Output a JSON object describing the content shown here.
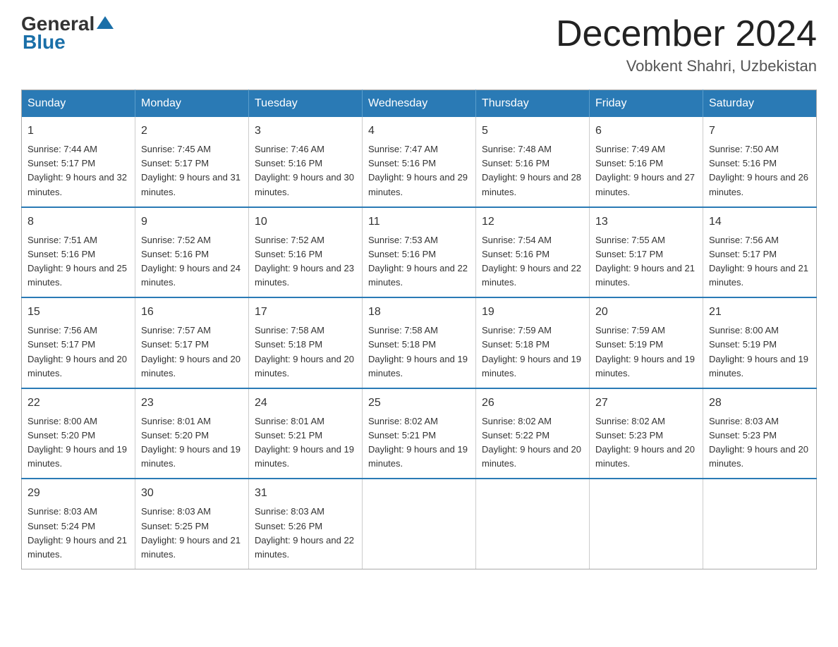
{
  "logo": {
    "general": "General",
    "blue": "Blue"
  },
  "title": "December 2024",
  "location": "Vobkent Shahri, Uzbekistan",
  "days_of_week": [
    "Sunday",
    "Monday",
    "Tuesday",
    "Wednesday",
    "Thursday",
    "Friday",
    "Saturday"
  ],
  "weeks": [
    [
      {
        "day": "1",
        "sunrise": "Sunrise: 7:44 AM",
        "sunset": "Sunset: 5:17 PM",
        "daylight": "Daylight: 9 hours and 32 minutes."
      },
      {
        "day": "2",
        "sunrise": "Sunrise: 7:45 AM",
        "sunset": "Sunset: 5:17 PM",
        "daylight": "Daylight: 9 hours and 31 minutes."
      },
      {
        "day": "3",
        "sunrise": "Sunrise: 7:46 AM",
        "sunset": "Sunset: 5:16 PM",
        "daylight": "Daylight: 9 hours and 30 minutes."
      },
      {
        "day": "4",
        "sunrise": "Sunrise: 7:47 AM",
        "sunset": "Sunset: 5:16 PM",
        "daylight": "Daylight: 9 hours and 29 minutes."
      },
      {
        "day": "5",
        "sunrise": "Sunrise: 7:48 AM",
        "sunset": "Sunset: 5:16 PM",
        "daylight": "Daylight: 9 hours and 28 minutes."
      },
      {
        "day": "6",
        "sunrise": "Sunrise: 7:49 AM",
        "sunset": "Sunset: 5:16 PM",
        "daylight": "Daylight: 9 hours and 27 minutes."
      },
      {
        "day": "7",
        "sunrise": "Sunrise: 7:50 AM",
        "sunset": "Sunset: 5:16 PM",
        "daylight": "Daylight: 9 hours and 26 minutes."
      }
    ],
    [
      {
        "day": "8",
        "sunrise": "Sunrise: 7:51 AM",
        "sunset": "Sunset: 5:16 PM",
        "daylight": "Daylight: 9 hours and 25 minutes."
      },
      {
        "day": "9",
        "sunrise": "Sunrise: 7:52 AM",
        "sunset": "Sunset: 5:16 PM",
        "daylight": "Daylight: 9 hours and 24 minutes."
      },
      {
        "day": "10",
        "sunrise": "Sunrise: 7:52 AM",
        "sunset": "Sunset: 5:16 PM",
        "daylight": "Daylight: 9 hours and 23 minutes."
      },
      {
        "day": "11",
        "sunrise": "Sunrise: 7:53 AM",
        "sunset": "Sunset: 5:16 PM",
        "daylight": "Daylight: 9 hours and 22 minutes."
      },
      {
        "day": "12",
        "sunrise": "Sunrise: 7:54 AM",
        "sunset": "Sunset: 5:16 PM",
        "daylight": "Daylight: 9 hours and 22 minutes."
      },
      {
        "day": "13",
        "sunrise": "Sunrise: 7:55 AM",
        "sunset": "Sunset: 5:17 PM",
        "daylight": "Daylight: 9 hours and 21 minutes."
      },
      {
        "day": "14",
        "sunrise": "Sunrise: 7:56 AM",
        "sunset": "Sunset: 5:17 PM",
        "daylight": "Daylight: 9 hours and 21 minutes."
      }
    ],
    [
      {
        "day": "15",
        "sunrise": "Sunrise: 7:56 AM",
        "sunset": "Sunset: 5:17 PM",
        "daylight": "Daylight: 9 hours and 20 minutes."
      },
      {
        "day": "16",
        "sunrise": "Sunrise: 7:57 AM",
        "sunset": "Sunset: 5:17 PM",
        "daylight": "Daylight: 9 hours and 20 minutes."
      },
      {
        "day": "17",
        "sunrise": "Sunrise: 7:58 AM",
        "sunset": "Sunset: 5:18 PM",
        "daylight": "Daylight: 9 hours and 20 minutes."
      },
      {
        "day": "18",
        "sunrise": "Sunrise: 7:58 AM",
        "sunset": "Sunset: 5:18 PM",
        "daylight": "Daylight: 9 hours and 19 minutes."
      },
      {
        "day": "19",
        "sunrise": "Sunrise: 7:59 AM",
        "sunset": "Sunset: 5:18 PM",
        "daylight": "Daylight: 9 hours and 19 minutes."
      },
      {
        "day": "20",
        "sunrise": "Sunrise: 7:59 AM",
        "sunset": "Sunset: 5:19 PM",
        "daylight": "Daylight: 9 hours and 19 minutes."
      },
      {
        "day": "21",
        "sunrise": "Sunrise: 8:00 AM",
        "sunset": "Sunset: 5:19 PM",
        "daylight": "Daylight: 9 hours and 19 minutes."
      }
    ],
    [
      {
        "day": "22",
        "sunrise": "Sunrise: 8:00 AM",
        "sunset": "Sunset: 5:20 PM",
        "daylight": "Daylight: 9 hours and 19 minutes."
      },
      {
        "day": "23",
        "sunrise": "Sunrise: 8:01 AM",
        "sunset": "Sunset: 5:20 PM",
        "daylight": "Daylight: 9 hours and 19 minutes."
      },
      {
        "day": "24",
        "sunrise": "Sunrise: 8:01 AM",
        "sunset": "Sunset: 5:21 PM",
        "daylight": "Daylight: 9 hours and 19 minutes."
      },
      {
        "day": "25",
        "sunrise": "Sunrise: 8:02 AM",
        "sunset": "Sunset: 5:21 PM",
        "daylight": "Daylight: 9 hours and 19 minutes."
      },
      {
        "day": "26",
        "sunrise": "Sunrise: 8:02 AM",
        "sunset": "Sunset: 5:22 PM",
        "daylight": "Daylight: 9 hours and 20 minutes."
      },
      {
        "day": "27",
        "sunrise": "Sunrise: 8:02 AM",
        "sunset": "Sunset: 5:23 PM",
        "daylight": "Daylight: 9 hours and 20 minutes."
      },
      {
        "day": "28",
        "sunrise": "Sunrise: 8:03 AM",
        "sunset": "Sunset: 5:23 PM",
        "daylight": "Daylight: 9 hours and 20 minutes."
      }
    ],
    [
      {
        "day": "29",
        "sunrise": "Sunrise: 8:03 AM",
        "sunset": "Sunset: 5:24 PM",
        "daylight": "Daylight: 9 hours and 21 minutes."
      },
      {
        "day": "30",
        "sunrise": "Sunrise: 8:03 AM",
        "sunset": "Sunset: 5:25 PM",
        "daylight": "Daylight: 9 hours and 21 minutes."
      },
      {
        "day": "31",
        "sunrise": "Sunrise: 8:03 AM",
        "sunset": "Sunset: 5:26 PM",
        "daylight": "Daylight: 9 hours and 22 minutes."
      },
      null,
      null,
      null,
      null
    ]
  ]
}
